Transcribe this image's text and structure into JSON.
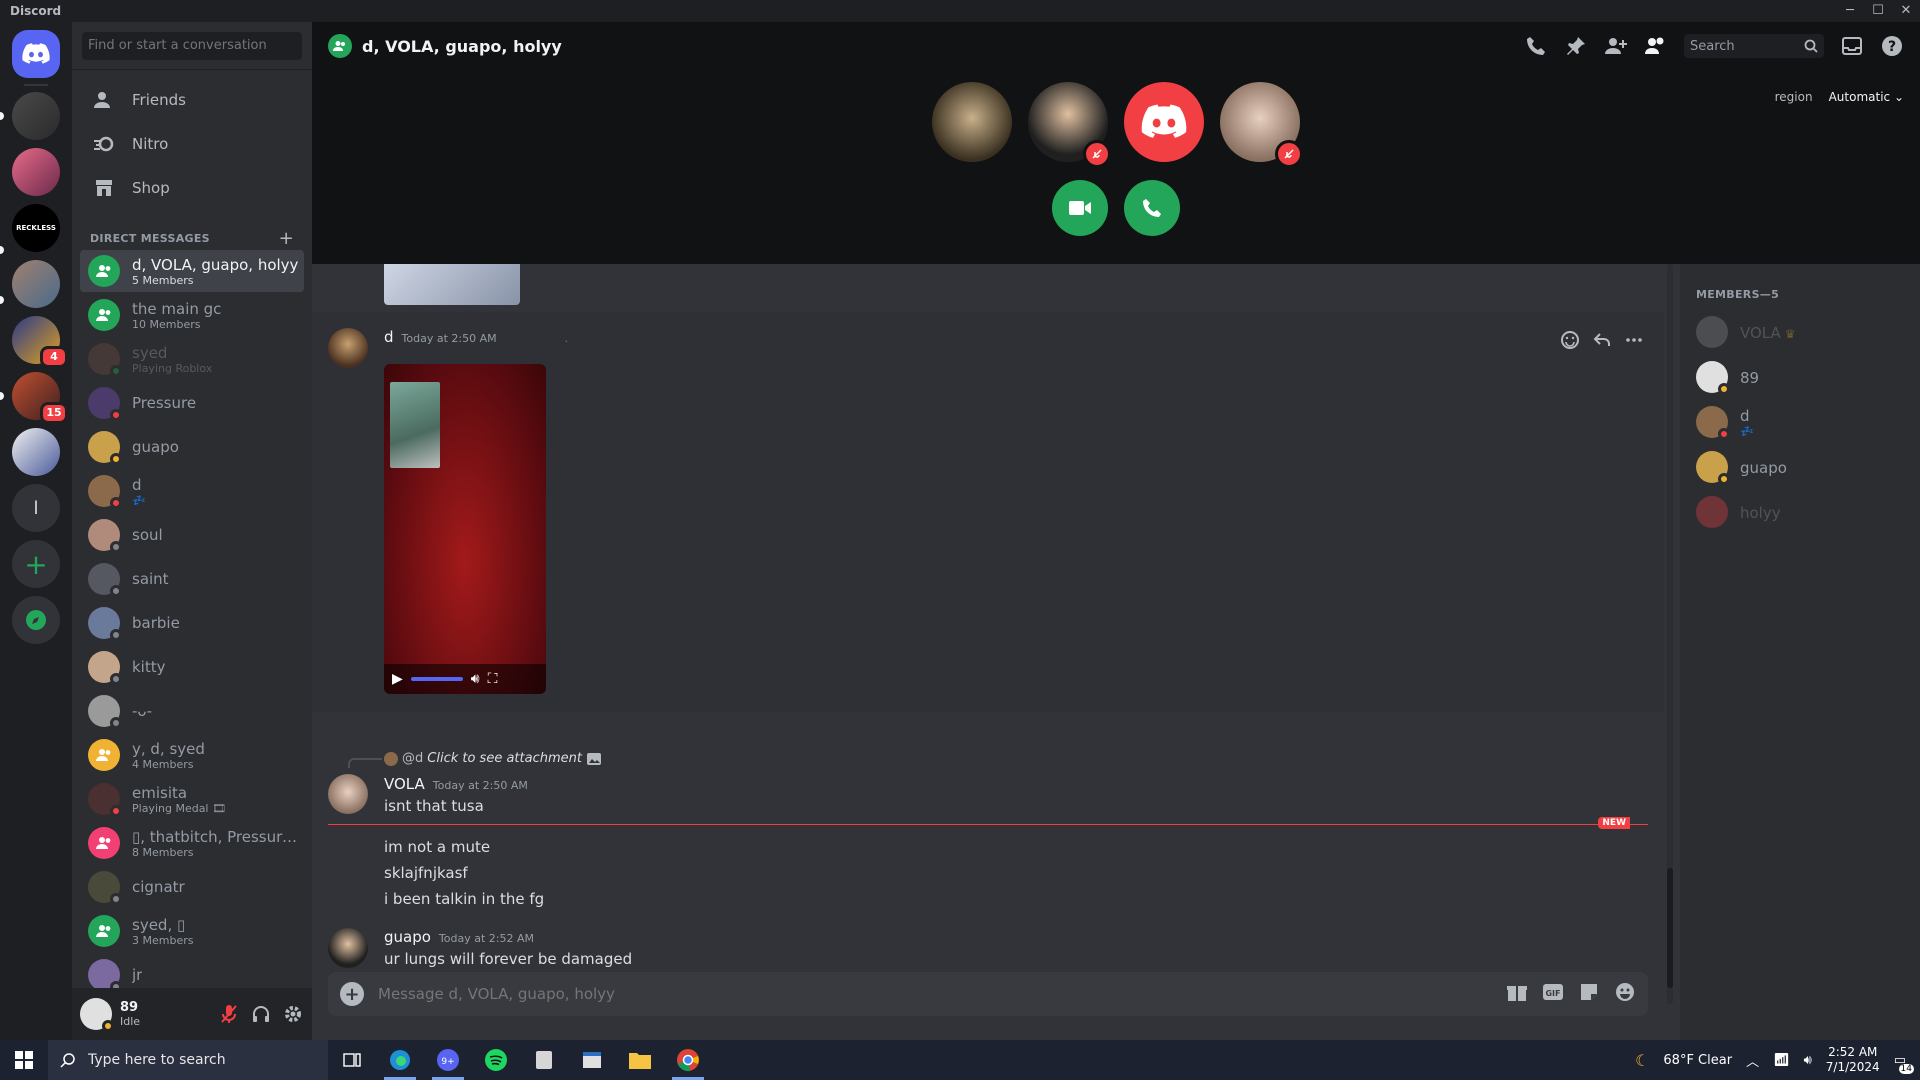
{
  "window": {
    "title": "Discord",
    "controls": [
      "─",
      "☐",
      "✕"
    ]
  },
  "guilds": [
    {
      "label": "",
      "badge": ""
    },
    {
      "label": "",
      "badge": ""
    },
    {
      "label": "RECKLESS",
      "badge": ""
    },
    {
      "label": "",
      "badge": ""
    },
    {
      "label": "",
      "badge": "4"
    },
    {
      "label": "",
      "badge": "15"
    },
    {
      "label": "",
      "badge": ""
    },
    {
      "label": "l",
      "badge": ""
    }
  ],
  "sidebar": {
    "search_placeholder": "Find or start a conversation",
    "nav": [
      {
        "label": "Friends",
        "icon": "friends-icon"
      },
      {
        "label": "Nitro",
        "icon": "nitro-icon"
      },
      {
        "label": "Shop",
        "icon": "shop-icon"
      }
    ],
    "dm_header": "DIRECT MESSAGES",
    "dms": [
      {
        "name": "d, VOLA, guapo, holyy",
        "sub": "5 Members",
        "group": true,
        "color": "#23a55a",
        "active": true
      },
      {
        "name": "the main gc",
        "sub": "10 Members",
        "group": true,
        "color": "#23a55a"
      },
      {
        "name": "syed",
        "sub": "Playing Roblox",
        "color": "#6b4b3e",
        "status": "online",
        "faded": true
      },
      {
        "name": "Pressure",
        "sub": "",
        "color": "#4a3b6b",
        "status": "dnd"
      },
      {
        "name": "guapo",
        "sub": "",
        "color": "#c9a14a",
        "status": "idle"
      },
      {
        "name": "d",
        "sub": "💤",
        "color": "#8a6a4a",
        "status": "dnd"
      },
      {
        "name": "soul",
        "sub": "",
        "color": "#b08a7a",
        "status": "off"
      },
      {
        "name": "saint",
        "sub": "",
        "color": "#555860",
        "status": "off"
      },
      {
        "name": "barbie",
        "sub": "",
        "color": "#6a7a9a",
        "status": "off"
      },
      {
        "name": "kitty",
        "sub": "",
        "color": "#c2a58a",
        "status": "off"
      },
      {
        "name": "-ᴗ-",
        "sub": "",
        "color": "#9a9a9a",
        "status": "off"
      },
      {
        "name": "y, d, syed",
        "sub": "4 Members",
        "group": true,
        "color": "#f0b232"
      },
      {
        "name": "emisita",
        "sub": "Playing Medal 🎞",
        "color": "#4a3030",
        "status": "dnd"
      },
      {
        "name": "▯, thatbitch, Pressure...",
        "sub": "8 Members",
        "group": true,
        "color": "#f23f74"
      },
      {
        "name": "cignatr",
        "sub": "",
        "color": "#4a4a3a",
        "status": "off"
      },
      {
        "name": "syed, ▯",
        "sub": "3 Members",
        "group": true,
        "color": "#23a55a"
      },
      {
        "name": "jr",
        "sub": "",
        "color": "#7a6aa0",
        "status": "off"
      }
    ],
    "user": {
      "name": "89",
      "status": "Idle"
    }
  },
  "header": {
    "title": "d, VOLA, guapo, holyy",
    "search_placeholder": "Search",
    "region_label": "region",
    "region_value": "Automatic"
  },
  "messages": {
    "d": {
      "author": "d",
      "time": "Today at 2:50 AM",
      "extra": "."
    },
    "reply": {
      "mention": "@d",
      "text": "Click to see attachment"
    },
    "vola": {
      "author": "VOLA",
      "time": "Today at 2:50 AM",
      "lines": [
        "isnt that tusa",
        "im not a mute",
        "sklajfnjkasf",
        "i been talkin in the fg"
      ]
    },
    "new_label": "NEW",
    "guapo": {
      "author": "guapo",
      "time": "Today at 2:52 AM",
      "lines": [
        "ur lungs will forever be damaged"
      ]
    }
  },
  "composer": {
    "placeholder": "Message d, VOLA, guapo, holyy",
    "gif_label": "GIF"
  },
  "members": {
    "header": "MEMBERS—5",
    "list": [
      {
        "name": "VOLA",
        "crown": "♛",
        "faded": true,
        "color": "#8a8a8a"
      },
      {
        "name": "89",
        "color": "#e0e0e0",
        "status": "idle"
      },
      {
        "name": "d",
        "sub": "💤",
        "color": "#8a6a4a",
        "status": "dnd"
      },
      {
        "name": "guapo",
        "color": "#c9a14a",
        "status": "idle"
      },
      {
        "name": "holyy",
        "faded": true,
        "color": "#f23f43"
      }
    ]
  },
  "taskbar": {
    "search_placeholder": "Type here to search",
    "weather": "68°F  Clear",
    "time": "2:52 AM",
    "date": "7/1/2024",
    "notif_count": "14",
    "discord_badge": "9+"
  },
  "colors": {
    "accent": "#5865f2",
    "green": "#23a55a",
    "red": "#f23f43"
  }
}
